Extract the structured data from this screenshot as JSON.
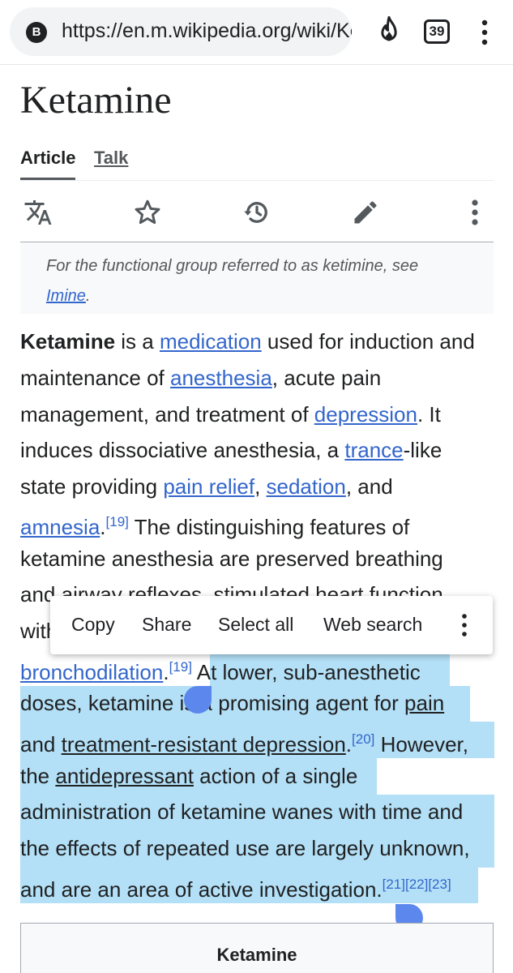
{
  "browser": {
    "site_badge": "B",
    "url": "https://en.m.wikipedia.org/wiki/Ketamine",
    "tab_count": "39"
  },
  "page": {
    "title": "Ketamine",
    "tabs": {
      "article": "Article",
      "talk": "Talk"
    },
    "actions": [
      "translate-icon",
      "star-icon",
      "history-icon",
      "edit-pencil-icon",
      "more-vert-icon"
    ]
  },
  "hatnote": {
    "prefix": "For the functional group referred to as ketimine, see",
    "link": "Imine",
    "suffix": "."
  },
  "para": {
    "l1_bold": "Ketamine",
    "l1_a": " is a ",
    "l1_link": "medication",
    "l1_b": " used for induction and",
    "l2_a": "maintenance of ",
    "l2_link": "anesthesia",
    "l2_b": ", acute pain",
    "l3_a": "management, and treatment of ",
    "l3_link": "depression",
    "l3_b": ". It",
    "l4_a": "induces dissociative anesthesia, a ",
    "l4_link": "trance",
    "l4_b": "-like",
    "l5_a": "state providing ",
    "l5_link1": "pain relief",
    "l5_b": ", ",
    "l5_link2": "sedation",
    "l5_c": ", and",
    "l6_link": "amnesia",
    "l6_a": ".",
    "l6_sup": "[19]",
    "l6_b": " The distinguishing features of",
    "l7": "ketamine anesthesia are preserved breathing",
    "l8": "and airway reflexes, stimulated heart function",
    "l9": "with",
    "l10_link": "bronchodilation",
    "l10_a": ".",
    "l10_sup": "[19]",
    "l10_b": " At lower, sub-anesthetic",
    "l11_a": "doses, ketamine is a promising agent for ",
    "l11_link": "pain",
    "l12_a": "and ",
    "l12_link": "treatment-resistant depression",
    "l12_b": ".",
    "l12_sup": "[20]",
    "l12_c": " However,",
    "l13_a": "the ",
    "l13_link": "antidepressant",
    "l13_b": " action of a single",
    "l14": "administration of ketamine wanes with time and",
    "l15": "the effects of repeated use are largely unknown,",
    "l16_a": "and are an area of active investigation.",
    "l16_sup": "[21][22][23]"
  },
  "context_menu": {
    "copy": "Copy",
    "share": "Share",
    "select_all": "Select all",
    "web_search": "Web search"
  },
  "infobox": {
    "title": "Ketamine"
  },
  "colors": {
    "link": "#3366cc",
    "selection": "#b3e0f7",
    "handle": "#5c88ee"
  }
}
